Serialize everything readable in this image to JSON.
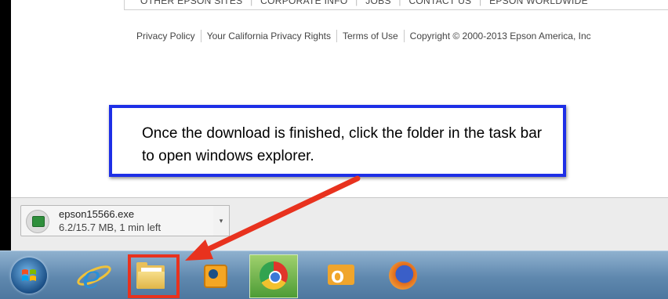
{
  "top_nav": {
    "items": [
      "OTHER EPSON SITES",
      "CORPORATE INFO",
      "JOBS",
      "CONTACT US",
      "EPSON WORLDWIDE"
    ]
  },
  "footer": {
    "links": [
      "Privacy Policy",
      "Your California Privacy Rights",
      "Terms of Use"
    ],
    "copyright": "Copyright © 2000-2013 Epson America, Inc"
  },
  "callout": {
    "text": "Once the download is finished, click the folder in the task bar to open windows explorer."
  },
  "download": {
    "filename": "epson15566.exe",
    "status": "6.2/15.7 MB, 1 min left",
    "menu_glyph": "▾"
  },
  "annotation_colors": {
    "callout_border": "#1e2fe6",
    "highlight_arrow": "#e8321e"
  },
  "taskbar": {
    "icons": [
      "windows-start-icon",
      "internet-explorer-icon",
      "folder-icon",
      "media-icon",
      "chrome-icon",
      "outlook-icon",
      "firefox-icon"
    ]
  }
}
